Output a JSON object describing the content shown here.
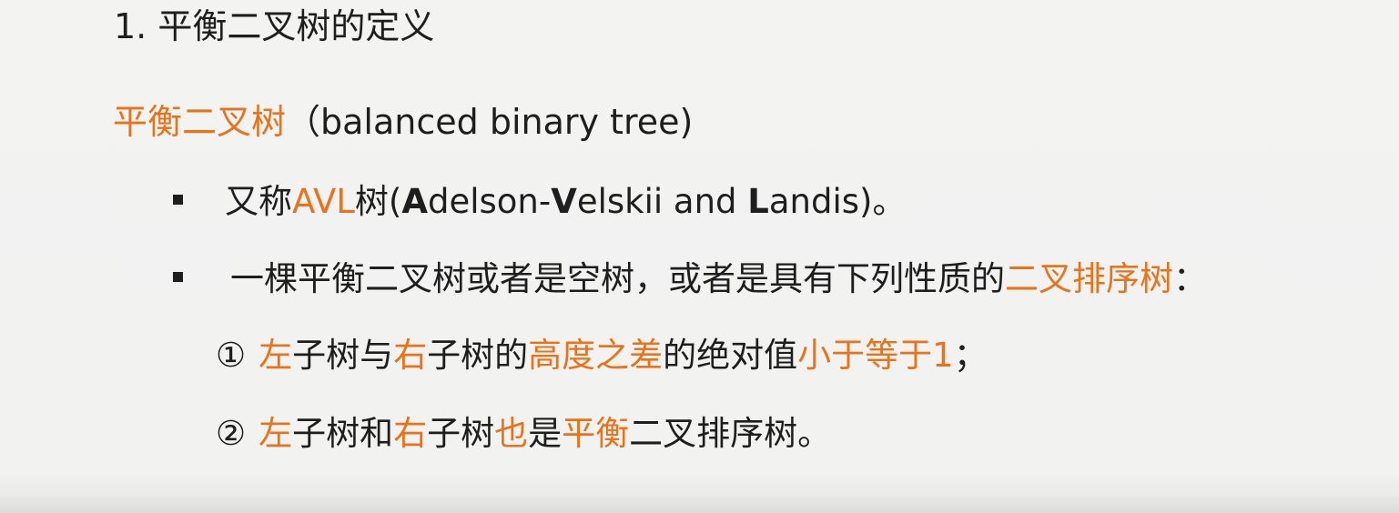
{
  "heading": "1. 平衡二叉树的定义",
  "subtitle": {
    "term": "平衡二叉树",
    "english": "（balanced binary tree)"
  },
  "bullet1": {
    "prefix": "又称",
    "avl": "AVL",
    "tree_open": "树(",
    "A": "A",
    "delson": "delson-",
    "V": "V",
    "elskii": "elskii and ",
    "L": "L",
    "andis": "andis)。"
  },
  "bullet2": {
    "text": "一棵平衡二叉树或者是空树，或者是具有下列性质的",
    "highlight": "二叉排序树",
    "colon": "："
  },
  "item1": {
    "marker": "①",
    "left": "左",
    "t1": "子树与",
    "right": "右",
    "t2": "子树的",
    "height_diff": "高度之差",
    "t3": "的绝对值",
    "le1": "小于等于1",
    "end": "；"
  },
  "item2": {
    "marker": "②",
    "left": "左",
    "t1": "子树和",
    "right": "右",
    "t2": "子树",
    "also": "也",
    "t3": "是",
    "balanced": "平衡",
    "t4": "二叉排序树。"
  },
  "colors": {
    "accent": "#e8731a",
    "text": "#1e1e1e",
    "background": "#f2f2f1"
  }
}
